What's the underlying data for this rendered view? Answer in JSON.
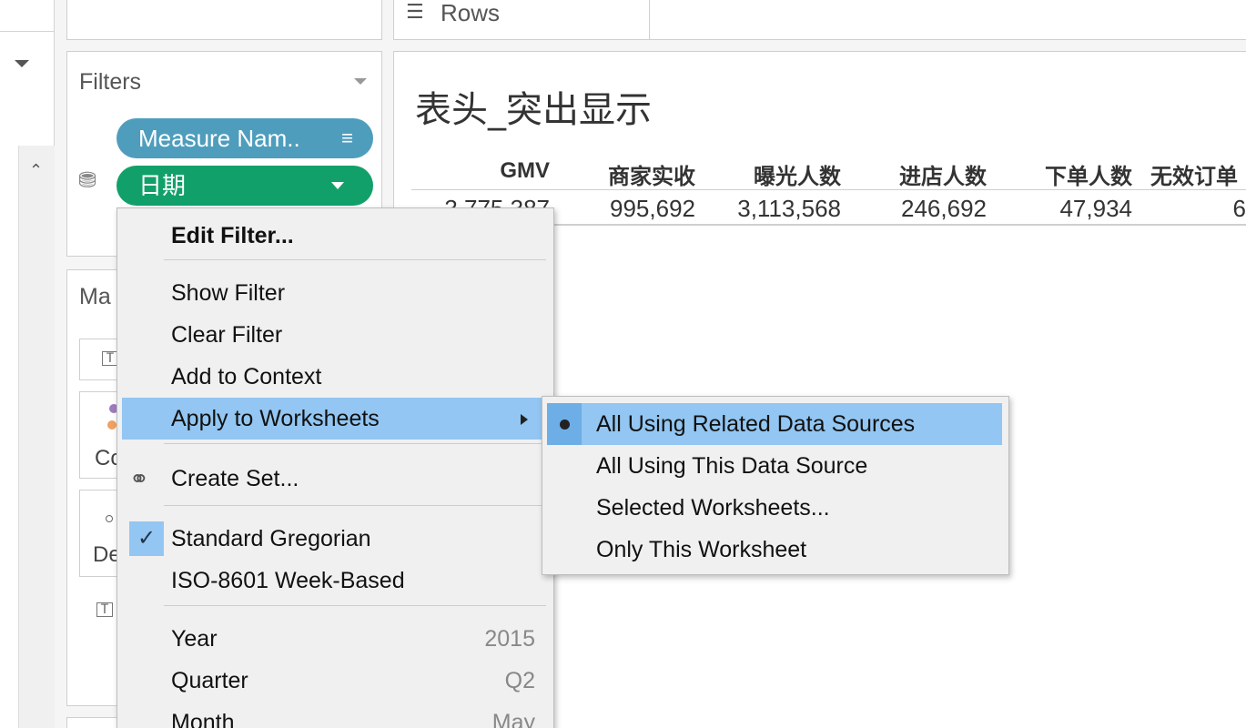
{
  "shelves": {
    "rows_label": "Rows",
    "rows_icon": "list-icon"
  },
  "filters": {
    "title": "Filters",
    "pills": [
      {
        "label": "Measure Nam..",
        "icon": "sort-bars-icon",
        "color": "#4f9dbd"
      },
      {
        "label": "日期",
        "icon": "chevron-down-icon",
        "color": "#12a06a"
      }
    ]
  },
  "marks": {
    "title_visible": "Ma",
    "card_color_label": "Co",
    "card_detail_label": "De",
    "text_icon_glyph": "T"
  },
  "worksheet": {
    "title": "表头_突出显示",
    "columns": [
      "GMV",
      "商家实收",
      "曝光人数",
      "进店人数",
      "下单人数",
      "无效订单"
    ],
    "values": [
      "3,775,387",
      "995,692",
      "3,113,568",
      "246,692",
      "47,934",
      "6"
    ]
  },
  "context_menu": {
    "items": [
      {
        "label": "Edit Filter..."
      },
      {
        "label": "Show Filter"
      },
      {
        "label": "Clear Filter"
      },
      {
        "label": "Add to Context"
      },
      {
        "label": "Apply to Worksheets"
      },
      {
        "label": "Create Set..."
      },
      {
        "label": "Standard Gregorian"
      },
      {
        "label": "ISO-8601 Week-Based"
      },
      {
        "label": "Year",
        "value": "2015"
      },
      {
        "label": "Quarter",
        "value": "Q2"
      },
      {
        "label": "Month",
        "value": "May"
      }
    ],
    "highlight_color": "#93c6f2"
  },
  "submenu": {
    "items": [
      {
        "label": "All Using Related Data Sources"
      },
      {
        "label": "All Using This Data Source"
      },
      {
        "label": "Selected Worksheets..."
      },
      {
        "label": "Only This Worksheet"
      }
    ]
  }
}
